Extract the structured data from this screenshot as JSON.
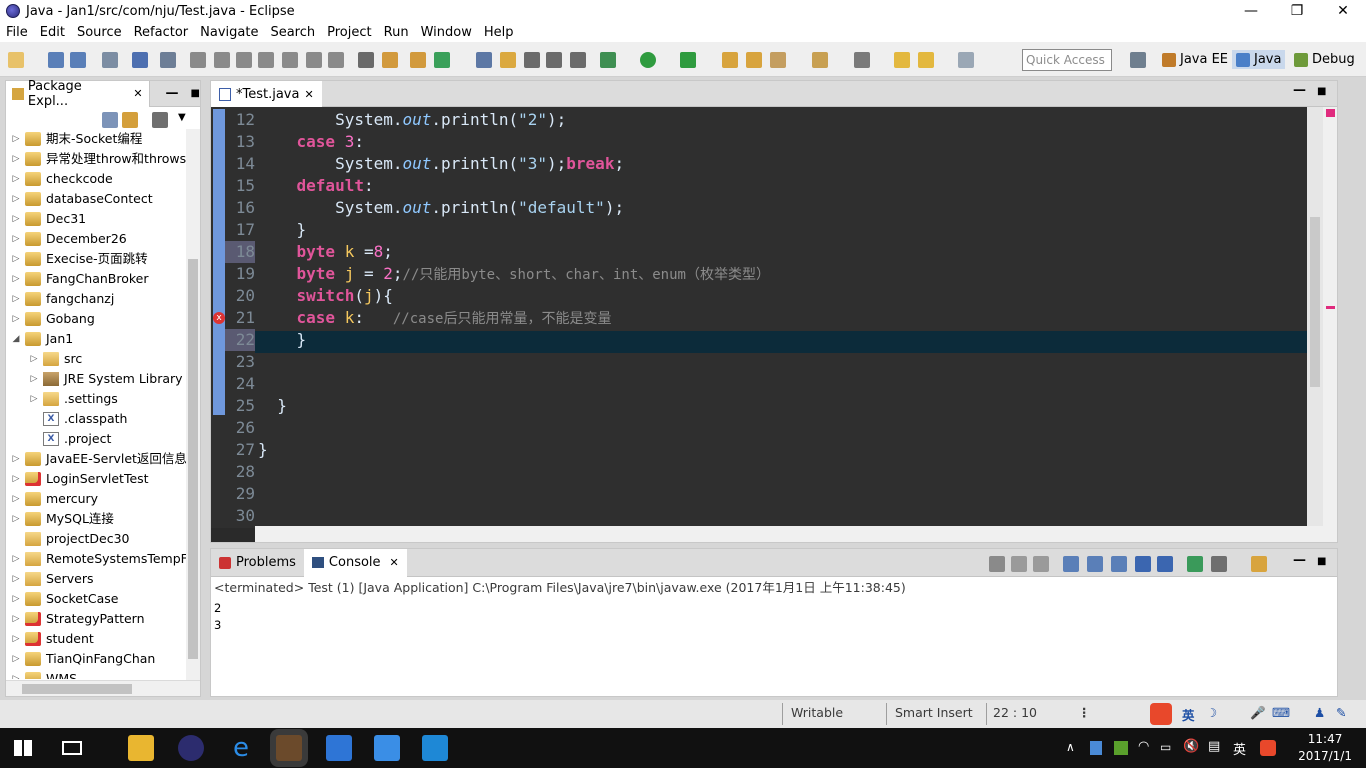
{
  "window": {
    "title": "Java - Jan1/src/com/nju/Test.java - Eclipse",
    "minimize": "—",
    "maximize": "❐",
    "close": "✕"
  },
  "menu": [
    "File",
    "Edit",
    "Source",
    "Refactor",
    "Navigate",
    "Search",
    "Project",
    "Run",
    "Window",
    "Help"
  ],
  "toolbar": {
    "quick_access": "Quick Access",
    "perspectives": [
      {
        "label": "Java EE",
        "color": "#c07b2a"
      },
      {
        "label": "Java",
        "color": "#4a7fc8",
        "active": true
      },
      {
        "label": "Debug",
        "color": "#6e9a3a"
      }
    ]
  },
  "package_explorer": {
    "title": "Package Expl...",
    "close": "✕",
    "items": [
      {
        "label": "期末-Socket编程",
        "depth": 0,
        "arrow": "▷",
        "icon": "ic-proj"
      },
      {
        "label": "异常处理throw和throws",
        "depth": 0,
        "arrow": "▷",
        "icon": "ic-proj"
      },
      {
        "label": "checkcode",
        "depth": 0,
        "arrow": "▷",
        "icon": "ic-proj"
      },
      {
        "label": "databaseContect",
        "depth": 0,
        "arrow": "▷",
        "icon": "ic-proj"
      },
      {
        "label": "Dec31",
        "depth": 0,
        "arrow": "▷",
        "icon": "ic-proj"
      },
      {
        "label": "December26",
        "depth": 0,
        "arrow": "▷",
        "icon": "ic-proj"
      },
      {
        "label": "Execise-页面跳转",
        "depth": 0,
        "arrow": "▷",
        "icon": "ic-proj"
      },
      {
        "label": "FangChanBroker",
        "depth": 0,
        "arrow": "▷",
        "icon": "ic-proj"
      },
      {
        "label": "fangchanzj",
        "depth": 0,
        "arrow": "▷",
        "icon": "ic-proj"
      },
      {
        "label": "Gobang",
        "depth": 0,
        "arrow": "▷",
        "icon": "ic-proj"
      },
      {
        "label": "Jan1",
        "depth": 0,
        "arrow": "◢",
        "icon": "ic-proj"
      },
      {
        "label": "src",
        "depth": 1,
        "arrow": "▷",
        "icon": "ic-folder"
      },
      {
        "label": "JRE System Library [",
        "depth": 1,
        "arrow": "▷",
        "icon": "ic-lib"
      },
      {
        "label": ".settings",
        "depth": 1,
        "arrow": "▷",
        "icon": "ic-folder"
      },
      {
        "label": ".classpath",
        "depth": 1,
        "arrow": "",
        "icon": "ic-xfile"
      },
      {
        "label": ".project",
        "depth": 1,
        "arrow": "",
        "icon": "ic-xfile"
      },
      {
        "label": "JavaEE-Servlet返回信息",
        "depth": 0,
        "arrow": "▷",
        "icon": "ic-proj"
      },
      {
        "label": "LoginServletTest",
        "depth": 0,
        "arrow": "▷",
        "icon": "ic-err"
      },
      {
        "label": "mercury",
        "depth": 0,
        "arrow": "▷",
        "icon": "ic-proj"
      },
      {
        "label": "MySQL连接",
        "depth": 0,
        "arrow": "▷",
        "icon": "ic-proj"
      },
      {
        "label": "projectDec30",
        "depth": 0,
        "arrow": "",
        "icon": "ic-folder"
      },
      {
        "label": "RemoteSystemsTempFil",
        "depth": 0,
        "arrow": "▷",
        "icon": "ic-folder"
      },
      {
        "label": "Servers",
        "depth": 0,
        "arrow": "▷",
        "icon": "ic-folder"
      },
      {
        "label": "SocketCase",
        "depth": 0,
        "arrow": "▷",
        "icon": "ic-proj"
      },
      {
        "label": "StrategyPattern",
        "depth": 0,
        "arrow": "▷",
        "icon": "ic-err"
      },
      {
        "label": "student",
        "depth": 0,
        "arrow": "▷",
        "icon": "ic-err"
      },
      {
        "label": "TianQinFangChan",
        "depth": 0,
        "arrow": "▷",
        "icon": "ic-proj"
      },
      {
        "label": "WMS",
        "depth": 0,
        "arrow": "▷",
        "icon": "ic-proj"
      }
    ]
  },
  "editor": {
    "tab": "*Test.java",
    "close": "✕",
    "lines": [
      {
        "n": "12",
        "tokens": [
          [
            "        ",
            ""
          ],
          [
            "System",
            ""
          ],
          [
            ".",
            ""
          ],
          [
            "out",
            "fld"
          ],
          [
            ".println(",
            ""
          ],
          [
            "\"2\"",
            "str"
          ],
          [
            ");",
            ""
          ]
        ]
      },
      {
        "n": "13",
        "tokens": [
          [
            "    ",
            ""
          ],
          [
            "case",
            "kw"
          ],
          [
            " ",
            ""
          ],
          [
            "3",
            "num"
          ],
          [
            ":",
            ""
          ]
        ]
      },
      {
        "n": "14",
        "tokens": [
          [
            "        ",
            ""
          ],
          [
            "System",
            ""
          ],
          [
            ".",
            ""
          ],
          [
            "out",
            "fld"
          ],
          [
            ".println(",
            ""
          ],
          [
            "\"3\"",
            "str"
          ],
          [
            ");",
            ""
          ],
          [
            "break",
            "kw"
          ],
          [
            ";",
            ""
          ]
        ]
      },
      {
        "n": "15",
        "tokens": [
          [
            "    ",
            ""
          ],
          [
            "default",
            "kw"
          ],
          [
            ":",
            ""
          ]
        ]
      },
      {
        "n": "16",
        "tokens": [
          [
            "        ",
            ""
          ],
          [
            "System",
            ""
          ],
          [
            ".",
            ""
          ],
          [
            "out",
            "fld"
          ],
          [
            ".println(",
            ""
          ],
          [
            "\"default\"",
            "str"
          ],
          [
            ");",
            ""
          ]
        ]
      },
      {
        "n": "17",
        "tokens": [
          [
            "    }",
            ""
          ]
        ]
      },
      {
        "n": "18",
        "tokens": [
          [
            "    ",
            ""
          ],
          [
            "byte",
            "kw"
          ],
          [
            " ",
            ""
          ],
          [
            "k",
            "var"
          ],
          [
            " =",
            ""
          ],
          [
            "8",
            "num"
          ],
          [
            ";",
            ""
          ]
        ]
      },
      {
        "n": "19",
        "tokens": [
          [
            "    ",
            ""
          ],
          [
            "byte",
            "kw"
          ],
          [
            " ",
            ""
          ],
          [
            "j",
            "var"
          ],
          [
            " = ",
            ""
          ],
          [
            "2",
            "num"
          ],
          [
            ";",
            ""
          ],
          [
            "//只能用byte、short、char、int、enum（枚举类型）",
            "cmt"
          ]
        ]
      },
      {
        "n": "20",
        "tokens": [
          [
            "    ",
            ""
          ],
          [
            "switch",
            "kw"
          ],
          [
            "(",
            ""
          ],
          [
            "j",
            "var"
          ],
          [
            "){",
            ""
          ]
        ]
      },
      {
        "n": "21",
        "tokens": [
          [
            "    ",
            ""
          ],
          [
            "case",
            "kw"
          ],
          [
            " ",
            ""
          ],
          [
            "k",
            "var"
          ],
          [
            ":   ",
            ""
          ],
          [
            "//case后只能用常量，不能是变量",
            "cmt"
          ]
        ]
      },
      {
        "n": "22",
        "tokens": [
          [
            "    }",
            ""
          ]
        ]
      },
      {
        "n": "23",
        "tokens": []
      },
      {
        "n": "24",
        "tokens": []
      },
      {
        "n": "25",
        "tokens": [
          [
            "  }",
            ""
          ]
        ]
      },
      {
        "n": "26",
        "tokens": []
      },
      {
        "n": "27",
        "tokens": [
          [
            "}",
            ""
          ]
        ]
      },
      {
        "n": "28",
        "tokens": []
      },
      {
        "n": "29",
        "tokens": []
      },
      {
        "n": "30",
        "tokens": []
      }
    ]
  },
  "console": {
    "tabs": [
      {
        "label": "Problems"
      },
      {
        "label": "Console",
        "active": true
      }
    ],
    "close": "✕",
    "info": "<terminated> Test (1) [Java Application] C:\\Program Files\\Java\\jre7\\bin\\javaw.exe (2017年1月1日 上午11:38:45)",
    "output": [
      "2",
      "3"
    ]
  },
  "status": {
    "writable": "Writable",
    "insert": "Smart Insert",
    "position": "22 : 10",
    "ime": "英"
  },
  "taskbar": {
    "time": "11:47",
    "date": "2017/1/1",
    "lang": "英"
  },
  "colors": {
    "keyword": "#e0559a",
    "string": "#a9d3f0",
    "number": "#fa71c6",
    "field": "#8fc8ff",
    "comment": "#8b8b8b",
    "var": "#f5c85e"
  }
}
